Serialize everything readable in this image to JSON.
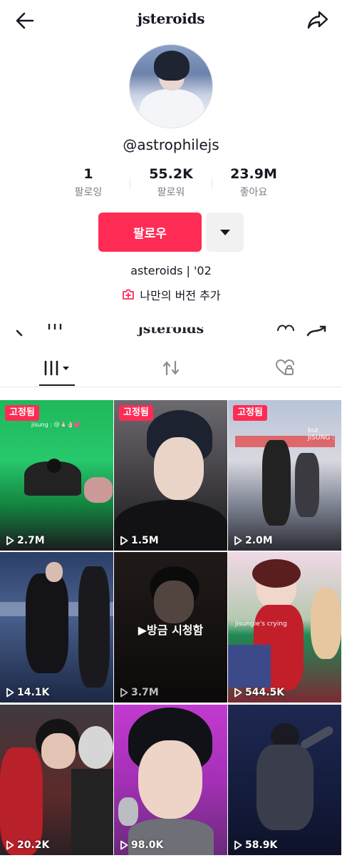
{
  "header": {
    "title": "jsteroids",
    "back_icon": "arrow-left-icon",
    "share_icon": "share-arrow-icon"
  },
  "profile": {
    "handle": "@astrophilejs",
    "stats": [
      {
        "value": "1",
        "label": "팔로잉"
      },
      {
        "value": "55.2K",
        "label": "팔로워"
      },
      {
        "value": "23.9M",
        "label": "좋아요"
      }
    ],
    "follow_label": "팔로우",
    "bio": "asteroids | '02",
    "add_version_label": "나만의 버전 추가"
  },
  "ghost_header": {
    "title": "jsteroids"
  },
  "tabs": [
    {
      "name": "videos",
      "icon": "grid-bars-icon",
      "active": true
    },
    {
      "name": "reposts",
      "icon": "repost-icon",
      "active": false
    },
    {
      "name": "liked",
      "icon": "heart-lock-icon",
      "active": false
    }
  ],
  "videos": [
    {
      "pinned": true,
      "pin_label": "고정됨",
      "views": "2.7M",
      "caption": "jisung : 😢🙏🏻👌🏻💕"
    },
    {
      "pinned": true,
      "pin_label": "고정됨",
      "views": "1.5M"
    },
    {
      "pinned": true,
      "pin_label": "고정됨",
      "views": "2.0M",
      "caption": "but JISUNG :"
    },
    {
      "pinned": false,
      "views": "14.1K"
    },
    {
      "pinned": false,
      "views": "3.7M",
      "watched_label": "▶방금 시청함"
    },
    {
      "pinned": false,
      "views": "544.5K",
      "caption": ": jisungie's crying"
    },
    {
      "pinned": false,
      "views": "20.2K"
    },
    {
      "pinned": false,
      "views": "98.0K"
    },
    {
      "pinned": false,
      "views": "58.9K"
    }
  ],
  "colors": {
    "accent": "#fe2c55",
    "text": "#161823",
    "muted": "#7d7e85"
  }
}
